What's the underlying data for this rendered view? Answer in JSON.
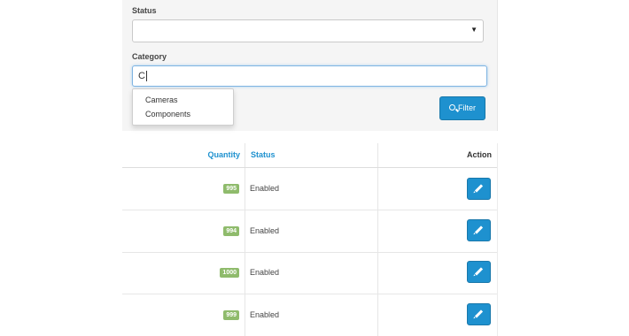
{
  "filter": {
    "status_label": "Status",
    "status_value": "",
    "category_label": "Category",
    "category_value": "C",
    "autocomplete": [
      "Cameras",
      "Components"
    ],
    "filter_button": "Filter"
  },
  "table": {
    "headers": {
      "quantity": "Quantity",
      "status": "Status",
      "action": "Action"
    },
    "rows": [
      {
        "quantity": "995",
        "status": "Enabled"
      },
      {
        "quantity": "994",
        "status": "Enabled"
      },
      {
        "quantity": "1000",
        "status": "Enabled"
      },
      {
        "quantity": "999",
        "status": "Enabled"
      }
    ]
  },
  "colors": {
    "primary": "#1e91cf",
    "badge_success": "#8fbb6c",
    "panel_bg": "#f5f5f5"
  },
  "icons": {
    "filter_button": "search-icon",
    "edit_button": "pencil-icon"
  }
}
